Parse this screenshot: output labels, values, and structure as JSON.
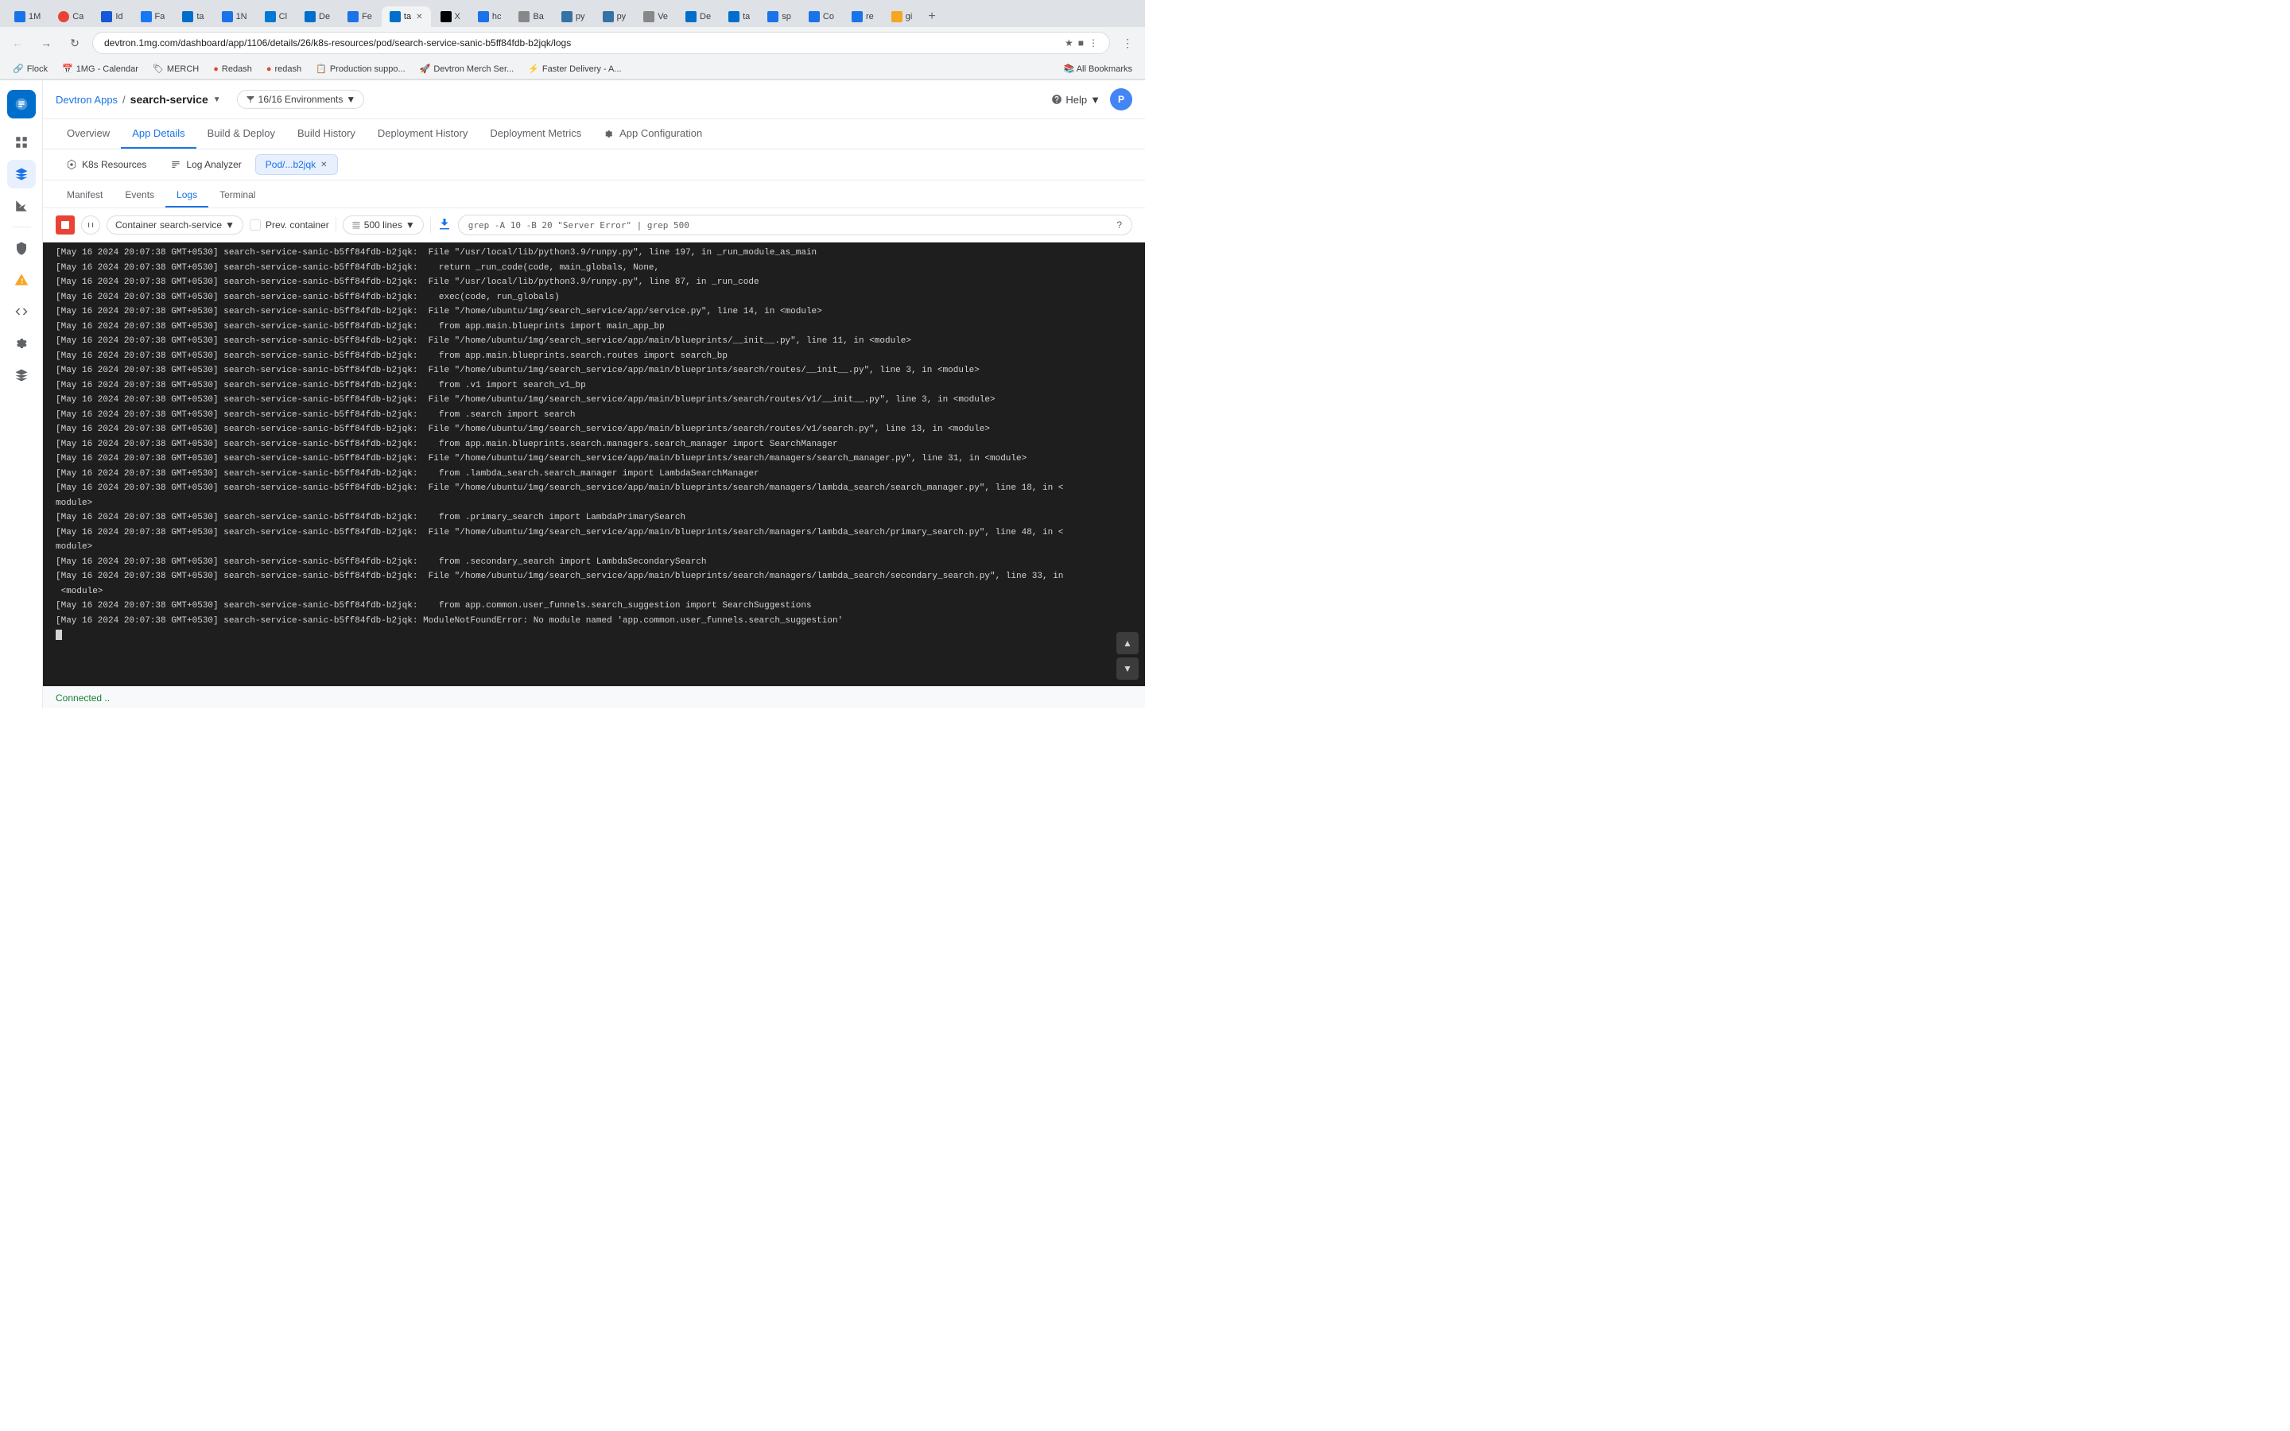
{
  "browser": {
    "url": "devtron.1mg.com/dashboard/app/1106/details/26/k8s-resources/pod/search-service-sanic-b5ff84fdb-b2jqk/logs",
    "tabs": [
      {
        "label": "1M",
        "favicon_color": "#1a73e8",
        "active": false
      },
      {
        "label": "Ca",
        "favicon_color": "#ea4335",
        "active": false
      },
      {
        "label": "Id",
        "favicon_color": "#1558d6",
        "active": false
      },
      {
        "label": "Fa",
        "favicon_color": "#1877f2",
        "active": false
      },
      {
        "label": "ta",
        "favicon_color": "#006fcb",
        "active": false
      },
      {
        "label": "1N",
        "favicon_color": "#1a73e8",
        "active": false
      },
      {
        "label": "Cl",
        "favicon_color": "#0078d4",
        "active": false
      },
      {
        "label": "De",
        "favicon_color": "#006fcb",
        "active": false
      },
      {
        "label": "Fe",
        "favicon_color": "#1a73e8",
        "active": false
      },
      {
        "label": "ta",
        "favicon_color": "#006fcb",
        "active": true
      },
      {
        "label": "X",
        "favicon_color": "#000",
        "active": false
      },
      {
        "label": "hc",
        "favicon_color": "#1a73e8",
        "active": false
      },
      {
        "label": "Ba",
        "favicon_color": "#5c5c5c",
        "active": false
      },
      {
        "label": "py",
        "favicon_color": "#3572A5",
        "active": false
      },
      {
        "label": "py",
        "favicon_color": "#3572A5",
        "active": false
      },
      {
        "label": "Ve",
        "favicon_color": "#5c5c5c",
        "active": false
      },
      {
        "label": "De",
        "favicon_color": "#006fcb",
        "active": false
      },
      {
        "label": "ta",
        "favicon_color": "#006fcb",
        "active": false
      },
      {
        "label": "sp",
        "favicon_color": "#1a73e8",
        "active": false
      },
      {
        "label": "Co",
        "favicon_color": "#1a73e8",
        "active": false
      },
      {
        "label": "re",
        "favicon_color": "#1a73e8",
        "active": false
      },
      {
        "label": "gi",
        "favicon_color": "#f5a623",
        "active": false
      }
    ],
    "bookmarks": [
      {
        "label": "Flock",
        "has_icon": true
      },
      {
        "label": "1MG - Calendar",
        "has_icon": true
      },
      {
        "label": "MERCH",
        "has_icon": true
      },
      {
        "label": "Redash",
        "has_icon": true
      },
      {
        "label": "redash",
        "has_icon": true
      },
      {
        "label": "Production suppo...",
        "has_icon": true
      },
      {
        "label": "Devtron Merch Ser...",
        "has_icon": true
      },
      {
        "label": "Faster Delivery - A...",
        "has_icon": true
      },
      {
        "label": "All Bookmarks",
        "has_icon": false
      }
    ]
  },
  "app": {
    "breadcrumb_app": "Devtron Apps",
    "breadcrumb_service": "search-service",
    "env_label": "16/16 Environments",
    "help_label": "Help",
    "user_initial": "P"
  },
  "nav_tabs": [
    {
      "label": "Overview",
      "active": false
    },
    {
      "label": "App Details",
      "active": true
    },
    {
      "label": "Build & Deploy",
      "active": false
    },
    {
      "label": "Build History",
      "active": false
    },
    {
      "label": "Deployment History",
      "active": false
    },
    {
      "label": "Deployment Metrics",
      "active": false
    },
    {
      "label": "App Configuration",
      "active": false
    }
  ],
  "sub_tabs": [
    {
      "label": "K8s Resources",
      "active": false,
      "icon": "k8s"
    },
    {
      "label": "Log Analyzer",
      "active": false,
      "icon": "log"
    },
    {
      "label": "Pod/...b2jqk",
      "active": true,
      "closeable": true
    }
  ],
  "inner_tabs": [
    {
      "label": "Manifest",
      "active": false
    },
    {
      "label": "Events",
      "active": false
    },
    {
      "label": "Logs",
      "active": true
    },
    {
      "label": "Terminal",
      "active": false
    }
  ],
  "log_toolbar": {
    "container_label": "Container",
    "container_value": "search-service",
    "prev_container_label": "Prev. container",
    "lines_label": "500 lines",
    "search_placeholder": "grep -A 10 -B 20 \"Server Error\" | grep 500"
  },
  "logs": [
    "[May 16 2024 20:07:38 GMT+0530] search-service-sanic-b5ff84fdb-b2jqk:  File \"/usr/local/lib/python3.9/runpy.py\", line 197, in _run_module_as_main",
    "[May 16 2024 20:07:38 GMT+0530] search-service-sanic-b5ff84fdb-b2jqk:    return _run_code(code, main_globals, None,",
    "[May 16 2024 20:07:38 GMT+0530] search-service-sanic-b5ff84fdb-b2jqk:  File \"/usr/local/lib/python3.9/runpy.py\", line 87, in _run_code",
    "[May 16 2024 20:07:38 GMT+0530] search-service-sanic-b5ff84fdb-b2jqk:    exec(code, run_globals)",
    "[May 16 2024 20:07:38 GMT+0530] search-service-sanic-b5ff84fdb-b2jqk:  File \"/home/ubuntu/1mg/search_service/app/service.py\", line 14, in <module>",
    "[May 16 2024 20:07:38 GMT+0530] search-service-sanic-b5ff84fdb-b2jqk:    from app.main.blueprints import main_app_bp",
    "[May 16 2024 20:07:38 GMT+0530] search-service-sanic-b5ff84fdb-b2jqk:  File \"/home/ubuntu/1mg/search_service/app/main/blueprints/__init__.py\", line 11, in <module>",
    "[May 16 2024 20:07:38 GMT+0530] search-service-sanic-b5ff84fdb-b2jqk:    from app.main.blueprints.search.routes import search_bp",
    "[May 16 2024 20:07:38 GMT+0530] search-service-sanic-b5ff84fdb-b2jqk:  File \"/home/ubuntu/1mg/search_service/app/main/blueprints/search/routes/__init__.py\", line 3, in <module>",
    "[May 16 2024 20:07:38 GMT+0530] search-service-sanic-b5ff84fdb-b2jqk:    from .v1 import search_v1_bp",
    "[May 16 2024 20:07:38 GMT+0530] search-service-sanic-b5ff84fdb-b2jqk:  File \"/home/ubuntu/1mg/search_service/app/main/blueprints/search/routes/v1/__init__.py\", line 3, in <module>",
    "[May 16 2024 20:07:38 GMT+0530] search-service-sanic-b5ff84fdb-b2jqk:    from .search import search",
    "[May 16 2024 20:07:38 GMT+0530] search-service-sanic-b5ff84fdb-b2jqk:  File \"/home/ubuntu/1mg/search_service/app/main/blueprints/search/routes/v1/search.py\", line 13, in <module>",
    "[May 16 2024 20:07:38 GMT+0530] search-service-sanic-b5ff84fdb-b2jqk:    from app.main.blueprints.search.managers.search_manager import SearchManager",
    "[May 16 2024 20:07:38 GMT+0530] search-service-sanic-b5ff84fdb-b2jqk:  File \"/home/ubuntu/1mg/search_service/app/main/blueprints/search/managers/search_manager.py\", line 31, in <module>",
    "[May 16 2024 20:07:38 GMT+0530] search-service-sanic-b5ff84fdb-b2jqk:    from .lambda_search.search_manager import LambdaSearchManager",
    "[May 16 2024 20:07:38 GMT+0530] search-service-sanic-b5ff84fdb-b2jqk:  File \"/home/ubuntu/1mg/search_service/app/main/blueprints/search/managers/lambda_search/search_manager.py\", line 18, in <",
    "module>",
    "[May 16 2024 20:07:38 GMT+0530] search-service-sanic-b5ff84fdb-b2jqk:    from .primary_search import LambdaPrimarySearch",
    "[May 16 2024 20:07:38 GMT+0530] search-service-sanic-b5ff84fdb-b2jqk:  File \"/home/ubuntu/1mg/search_service/app/main/blueprints/search/managers/lambda_search/primary_search.py\", line 48, in <",
    "module>",
    "[May 16 2024 20:07:38 GMT+0530] search-service-sanic-b5ff84fdb-b2jqk:    from .secondary_search import LambdaSecondarySearch",
    "[May 16 2024 20:07:38 GMT+0530] search-service-sanic-b5ff84fdb-b2jqk:  File \"/home/ubuntu/1mg/search_service/app/main/blueprints/search/managers/lambda_search/secondary_search.py\", line 33, in",
    " <module>",
    "[May 16 2024 20:07:38 GMT+0530] search-service-sanic-b5ff84fdb-b2jqk:    from app.common.user_funnels.search_suggestion import SearchSuggestions",
    "[May 16 2024 20:07:38 GMT+0530] search-service-sanic-b5ff84fdb-b2jqk: ModuleNotFoundError: No module named 'app.common.user_funnels.search_suggestion'"
  ],
  "status": {
    "connected_label": "Connected .."
  },
  "colors": {
    "accent": "#1a73e8",
    "stop_red": "#ea4335",
    "log_bg": "#1e1e1e",
    "log_text": "#d4d4d4",
    "connected_green": "#188038"
  }
}
